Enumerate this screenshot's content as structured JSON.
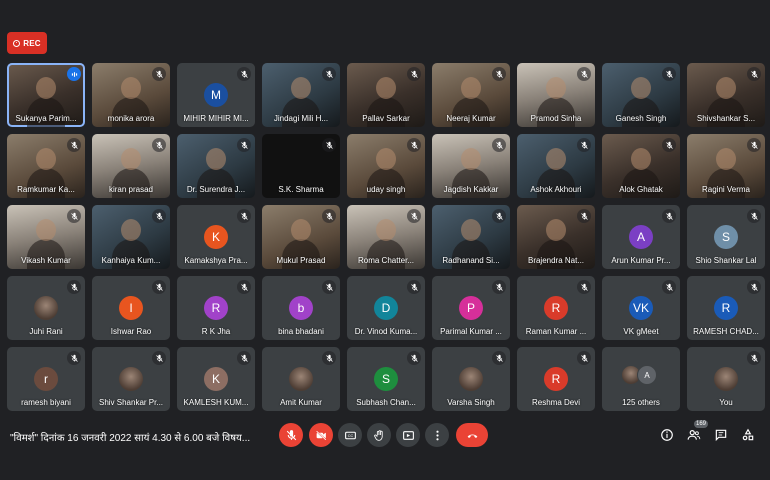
{
  "recording": {
    "label": "REC"
  },
  "participants": [
    {
      "name": "Sukanya Parim...",
      "kind": "video",
      "speaking": true
    },
    {
      "name": "monika arora",
      "kind": "video"
    },
    {
      "name": "MIHIR MIHIR MI...",
      "kind": "letter",
      "initial": "M",
      "color": "#1a4fa0"
    },
    {
      "name": "Jindagi Mili H...",
      "kind": "video"
    },
    {
      "name": "Pallav Sarkar",
      "kind": "video"
    },
    {
      "name": "Neeraj Kumar",
      "kind": "video"
    },
    {
      "name": "Pramod Sinha",
      "kind": "video"
    },
    {
      "name": "Ganesh Singh",
      "kind": "video"
    },
    {
      "name": "Shivshankar S...",
      "kind": "video"
    },
    {
      "name": "Ramkumar Ka...",
      "kind": "video"
    },
    {
      "name": "kiran prasad",
      "kind": "video"
    },
    {
      "name": "Dr. Surendra J...",
      "kind": "video"
    },
    {
      "name": "S.K. Sharma",
      "kind": "dark"
    },
    {
      "name": "uday singh",
      "kind": "video"
    },
    {
      "name": "Jagdish Kakkar",
      "kind": "video"
    },
    {
      "name": "Ashok Akhouri",
      "kind": "video"
    },
    {
      "name": "Alok Ghatak",
      "kind": "video"
    },
    {
      "name": "Ragini Verma",
      "kind": "video"
    },
    {
      "name": "Vikash Kumar",
      "kind": "video"
    },
    {
      "name": "Kanhaiya Kum...",
      "kind": "video"
    },
    {
      "name": "Kamakshya Pra...",
      "kind": "letter",
      "initial": "K",
      "color": "#e8551f"
    },
    {
      "name": "Mukul Prasad",
      "kind": "video"
    },
    {
      "name": "Roma Chatter...",
      "kind": "video"
    },
    {
      "name": "Radhanand Si...",
      "kind": "video"
    },
    {
      "name": "Brajendra Nat...",
      "kind": "video"
    },
    {
      "name": "Arun Kumar Pr...",
      "kind": "letter",
      "initial": "A",
      "color": "#7b3fc4"
    },
    {
      "name": "Shio Shankar Lal",
      "kind": "letter",
      "initial": "S",
      "color": "#6f8fa8"
    },
    {
      "name": "Juhi Rani",
      "kind": "photo"
    },
    {
      "name": "Ishwar Rao",
      "kind": "letter",
      "initial": "I",
      "color": "#e8551f"
    },
    {
      "name": "R K Jha",
      "kind": "letter",
      "initial": "R",
      "color": "#a142c9"
    },
    {
      "name": "bina bhadani",
      "kind": "letter",
      "initial": "b",
      "color": "#a142c9"
    },
    {
      "name": "Dr. Vinod Kuma...",
      "kind": "letter",
      "initial": "D",
      "color": "#12859a"
    },
    {
      "name": "Parimal Kumar ...",
      "kind": "letter",
      "initial": "P",
      "color": "#d62f9a"
    },
    {
      "name": "Raman Kumar ...",
      "kind": "letter",
      "initial": "R",
      "color": "#d93b2a"
    },
    {
      "name": "VK gMeet",
      "kind": "letter",
      "initial": "VK",
      "color": "#1a5bb8"
    },
    {
      "name": "RAMESH CHAD...",
      "kind": "letter",
      "initial": "R",
      "color": "#1a5bb8"
    },
    {
      "name": "ramesh biyani",
      "kind": "letter",
      "initial": "r",
      "color": "#6b4b3e"
    },
    {
      "name": "Shiv Shankar Pr...",
      "kind": "photo"
    },
    {
      "name": "KAMLESH KUM...",
      "kind": "letter",
      "initial": "K",
      "color": "#8d6e63"
    },
    {
      "name": "Amit Kumar",
      "kind": "photo"
    },
    {
      "name": "Subhash Chan...",
      "kind": "letter",
      "initial": "S",
      "color": "#1e8e3e"
    },
    {
      "name": "Varsha Singh",
      "kind": "photo"
    },
    {
      "name": "Reshma Devi",
      "kind": "letter",
      "initial": "R",
      "color": "#d93b2a"
    },
    {
      "name": "125 others",
      "kind": "others",
      "avatar_letter": "A"
    },
    {
      "name": "You",
      "kind": "photo"
    }
  ],
  "bottom": {
    "meeting_title": "\"विमर्श\" दिनांक 16 जनवरी 2022 सायं 4.30 से 6.00 बजे विषय...",
    "participants_count": "169"
  }
}
